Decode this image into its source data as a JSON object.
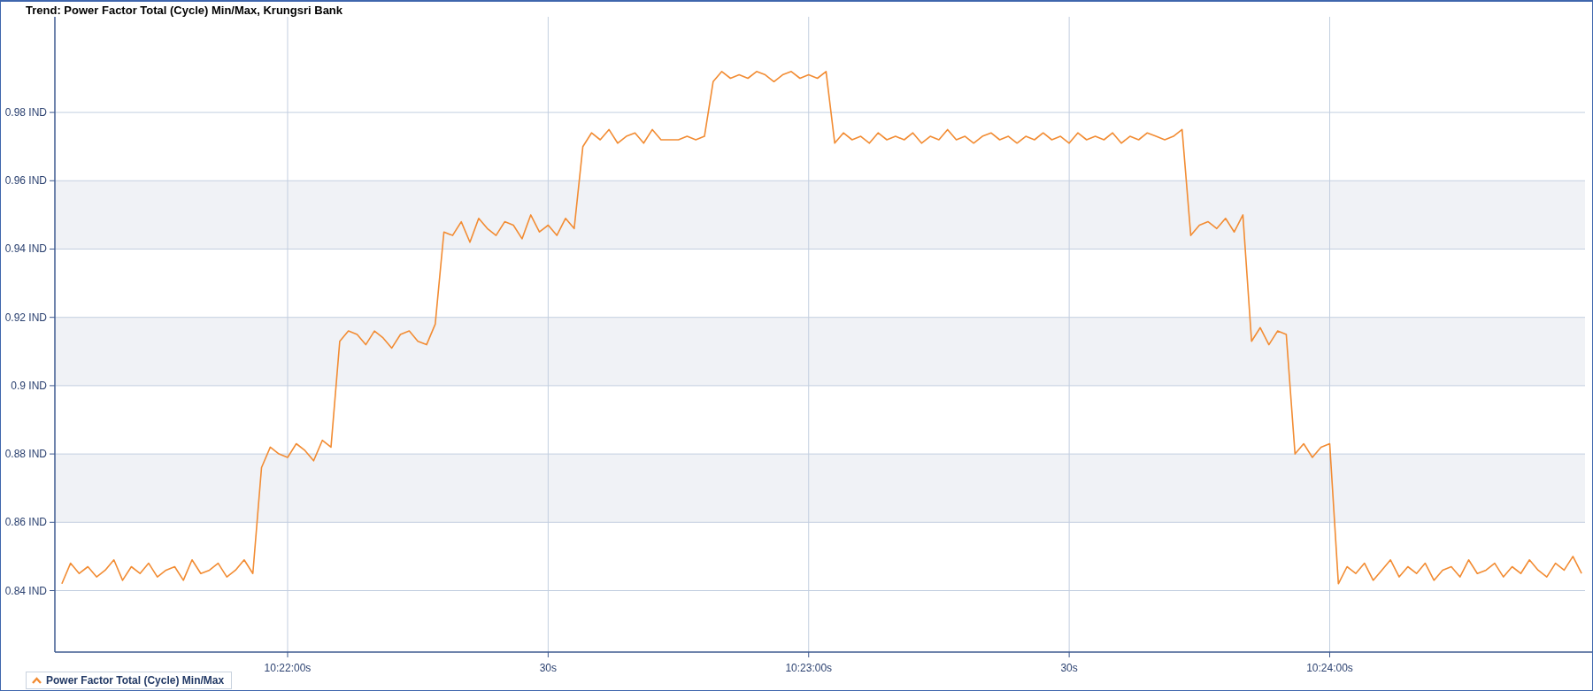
{
  "window": {
    "title": "Trend: Power Factor Total (Cycle) Min/Max, Krungsri Bank"
  },
  "chart": {
    "chart_data": {
      "type": "line",
      "grid": true,
      "ylim": [
        0.822,
        1.008
      ],
      "categories": [
        null,
        null,
        null,
        null,
        null,
        null,
        null,
        null,
        null,
        null,
        null,
        null,
        null,
        null,
        null,
        null,
        null,
        null,
        null,
        null,
        null,
        null,
        null,
        null,
        null,
        null,
        "10:22:00s",
        null,
        null,
        null,
        null,
        null,
        null,
        null,
        null,
        null,
        null,
        null,
        null,
        null,
        null,
        null,
        null,
        null,
        null,
        null,
        null,
        null,
        null,
        null,
        null,
        null,
        null,
        null,
        null,
        null,
        "30s",
        null,
        null,
        null,
        null,
        null,
        null,
        null,
        null,
        null,
        null,
        null,
        null,
        null,
        null,
        null,
        null,
        null,
        null,
        null,
        null,
        null,
        null,
        null,
        null,
        null,
        null,
        null,
        null,
        null,
        "10:23:00s",
        null,
        null,
        null,
        null,
        null,
        null,
        null,
        null,
        null,
        null,
        null,
        null,
        null,
        null,
        null,
        null,
        null,
        null,
        null,
        null,
        null,
        null,
        null,
        null,
        null,
        null,
        null,
        null,
        null,
        "30s",
        null,
        null,
        null,
        null,
        null,
        null,
        null,
        null,
        null,
        null,
        null,
        null,
        null,
        null,
        null,
        null,
        null,
        null,
        null,
        null,
        null,
        null,
        null,
        null,
        null,
        null,
        null,
        null,
        null,
        "10:24:00s",
        null,
        null,
        null,
        null,
        null,
        null,
        null,
        null,
        null,
        null,
        null,
        null,
        null,
        null,
        null,
        null,
        null,
        null,
        null,
        null,
        null,
        null,
        null,
        null,
        null,
        null,
        null,
        null,
        null
      ],
      "yticks": [
        {
          "value": 0.84,
          "label": "0.84 IND"
        },
        {
          "value": 0.86,
          "label": "0.86 IND"
        },
        {
          "value": 0.88,
          "label": "0.88 IND"
        },
        {
          "value": 0.9,
          "label": "0.9 IND"
        },
        {
          "value": 0.92,
          "label": "0.92 IND"
        },
        {
          "value": 0.94,
          "label": "0.94 IND"
        },
        {
          "value": 0.96,
          "label": "0.96 IND"
        },
        {
          "value": 0.98,
          "label": "0.98 IND"
        }
      ],
      "series": [
        {
          "name": "Power Factor Total (Cycle) Min/Max",
          "color": "#f28c33",
          "values": [
            0.842,
            0.848,
            0.845,
            0.847,
            0.844,
            0.846,
            0.849,
            0.843,
            0.847,
            0.845,
            0.848,
            0.844,
            0.846,
            0.847,
            0.843,
            0.849,
            0.845,
            0.846,
            0.848,
            0.844,
            0.846,
            0.849,
            0.845,
            0.876,
            0.882,
            0.88,
            0.879,
            0.883,
            0.881,
            0.878,
            0.884,
            0.882,
            0.913,
            0.916,
            0.915,
            0.912,
            0.916,
            0.914,
            0.911,
            0.915,
            0.916,
            0.913,
            0.912,
            0.918,
            0.945,
            0.944,
            0.948,
            0.942,
            0.949,
            0.946,
            0.944,
            0.948,
            0.947,
            0.943,
            0.95,
            0.945,
            0.947,
            0.944,
            0.949,
            0.946,
            0.97,
            0.974,
            0.972,
            0.975,
            0.971,
            0.973,
            0.974,
            0.971,
            0.975,
            0.972,
            0.972,
            0.972,
            0.973,
            0.972,
            0.973,
            0.989,
            0.992,
            0.99,
            0.991,
            0.99,
            0.992,
            0.991,
            0.989,
            0.991,
            0.992,
            0.99,
            0.991,
            0.99,
            0.992,
            0.971,
            0.974,
            0.972,
            0.973,
            0.971,
            0.974,
            0.972,
            0.973,
            0.972,
            0.974,
            0.971,
            0.973,
            0.972,
            0.975,
            0.972,
            0.973,
            0.971,
            0.973,
            0.974,
            0.972,
            0.973,
            0.971,
            0.973,
            0.972,
            0.974,
            0.972,
            0.973,
            0.971,
            0.974,
            0.972,
            0.973,
            0.972,
            0.974,
            0.971,
            0.973,
            0.972,
            0.974,
            0.973,
            0.972,
            0.973,
            0.975,
            0.944,
            0.947,
            0.948,
            0.946,
            0.949,
            0.945,
            0.95,
            0.913,
            0.917,
            0.912,
            0.916,
            0.915,
            0.88,
            0.883,
            0.879,
            0.882,
            0.883,
            0.842,
            0.847,
            0.845,
            0.848,
            0.843,
            0.846,
            0.849,
            0.844,
            0.847,
            0.845,
            0.848,
            0.843,
            0.846,
            0.847,
            0.844,
            0.849,
            0.845,
            0.846,
            0.848,
            0.844,
            0.847,
            0.845,
            0.849,
            0.846,
            0.844,
            0.848,
            0.846,
            0.85,
            0.845
          ]
        }
      ]
    }
  }
}
